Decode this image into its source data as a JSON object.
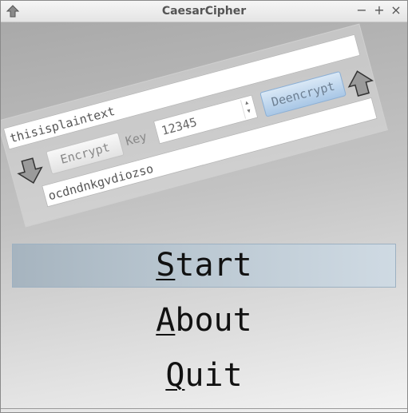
{
  "window": {
    "title": "CaesarCipher"
  },
  "titlebar_buttons": {
    "minimize": "−",
    "maximize": "+",
    "close": "×"
  },
  "cipher_panel": {
    "plaintext": "thisisplaintext",
    "encrypt_label": "Encrypt",
    "key_label": "Key",
    "key_value": "12345",
    "decrypt_label": "Deencrypt",
    "ciphertext": "ocdndnkgvdiozso"
  },
  "menu": {
    "start": {
      "mnemonic": "S",
      "rest": "tart"
    },
    "about": {
      "mnemonic": "A",
      "rest": "bout"
    },
    "quit": {
      "mnemonic": "Q",
      "rest": "uit"
    }
  },
  "icons": {
    "app": "home-up-arrow-icon",
    "encrypt_direction": "arrow-down-icon",
    "decrypt_direction": "arrow-up-icon"
  },
  "colors": {
    "start_highlight": "#bcc9d3",
    "decrypt_button": "#a9c7e6"
  }
}
